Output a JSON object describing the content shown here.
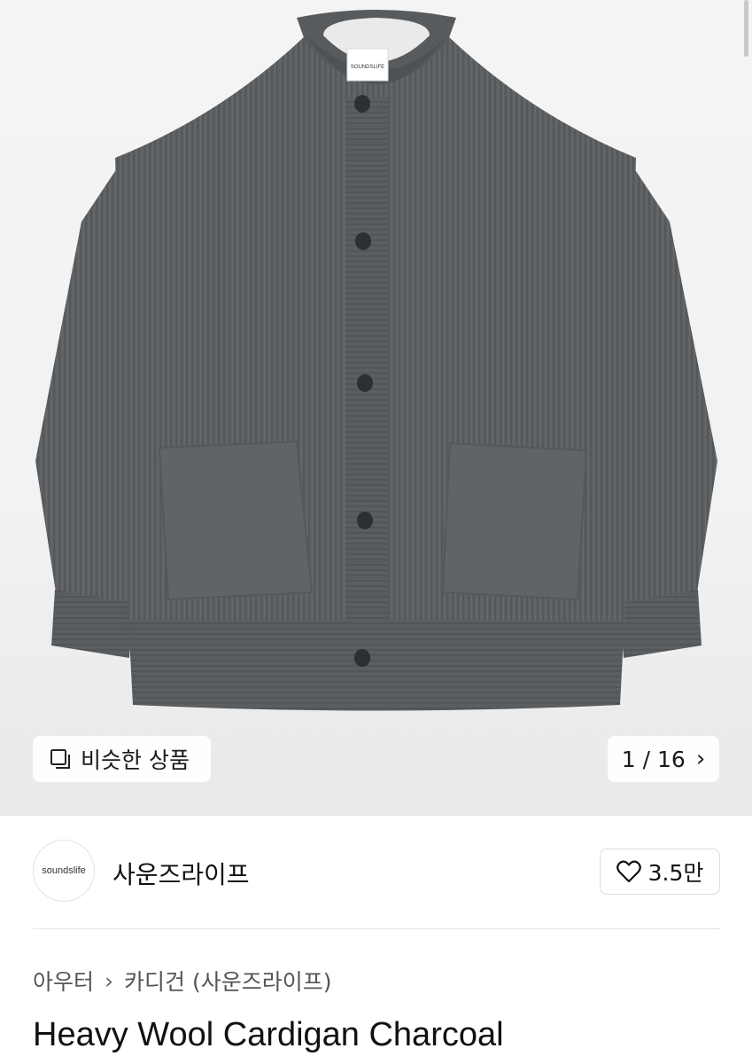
{
  "gallery": {
    "similar_label": "비슷한 상품",
    "counter": "1 / 16",
    "tag_text": "SOUNDSLIFE"
  },
  "brand": {
    "logo_text": "soundslife",
    "name": "사운즈라이프",
    "likes": "3.5만"
  },
  "breadcrumb": {
    "items": [
      "아우터",
      "카디건 (사운즈라이프)"
    ]
  },
  "product": {
    "title": "Heavy Wool Cardigan Charcoal"
  },
  "colors": {
    "knit": "#5d6063",
    "background": "#f2f2f2"
  }
}
